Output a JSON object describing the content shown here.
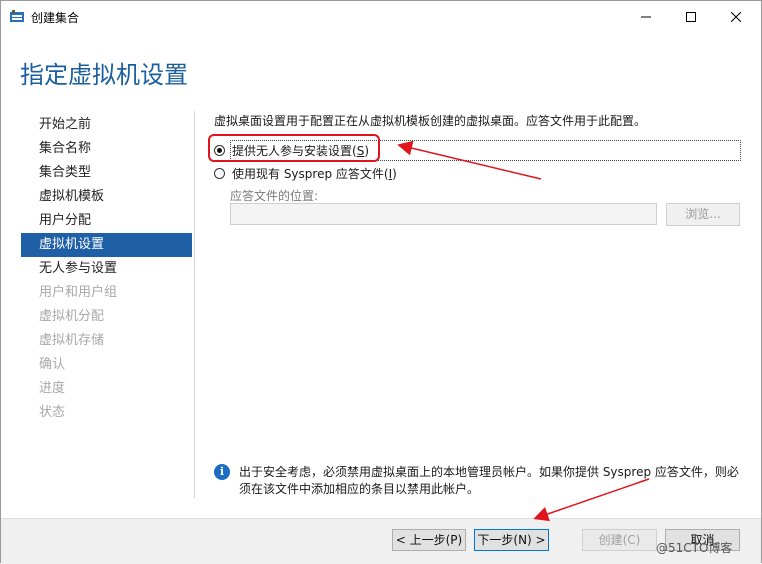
{
  "window": {
    "title": "创建集合",
    "minimize_glyph": "—",
    "maximize_glyph": "☐",
    "close_glyph": "✕"
  },
  "page_title": "指定虚拟机设置",
  "nav": {
    "items": [
      {
        "label": "开始之前",
        "state": "normal"
      },
      {
        "label": "集合名称",
        "state": "normal"
      },
      {
        "label": "集合类型",
        "state": "normal"
      },
      {
        "label": "虚拟机模板",
        "state": "normal"
      },
      {
        "label": "用户分配",
        "state": "normal"
      },
      {
        "label": "虚拟机设置",
        "state": "active"
      },
      {
        "label": "无人参与设置",
        "state": "normal"
      },
      {
        "label": "用户和用户组",
        "state": "disabled"
      },
      {
        "label": "虚拟机分配",
        "state": "disabled"
      },
      {
        "label": "虚拟机存储",
        "state": "disabled"
      },
      {
        "label": "确认",
        "state": "disabled"
      },
      {
        "label": "进度",
        "state": "disabled"
      },
      {
        "label": "状态",
        "state": "disabled"
      }
    ]
  },
  "content": {
    "description": "虚拟桌面设置用于配置正在从虚拟机模板创建的虚拟桌面。应答文件用于此配置。",
    "option_unattended": {
      "label": "提供无人参与安装设置(",
      "accel": "S",
      "suffix": ")",
      "selected": true
    },
    "option_sysprep": {
      "label": "使用现有 Sysprep 应答文件(",
      "accel": "I",
      "suffix": ")",
      "selected": false
    },
    "answer_file_label": "应答文件的位置:",
    "answer_file_value": "",
    "browse_label": "浏览..."
  },
  "info": {
    "icon": "info-icon",
    "text": "出于安全考虑，必须禁用虚拟桌面上的本地管理员帐户。如果你提供 Sysprep 应答文件，则必须在该文件中添加相应的条目以禁用此帐户。"
  },
  "footer": {
    "prev_label": "< 上一步(P)",
    "next_label": "下一步(N) >",
    "create_label": "创建(C)",
    "cancel_label": "取消"
  },
  "watermark": "@51CTO博客",
  "colors": {
    "accent": "#1f5fa6",
    "title": "#1b5f9f",
    "annotation": "#e0141d"
  }
}
